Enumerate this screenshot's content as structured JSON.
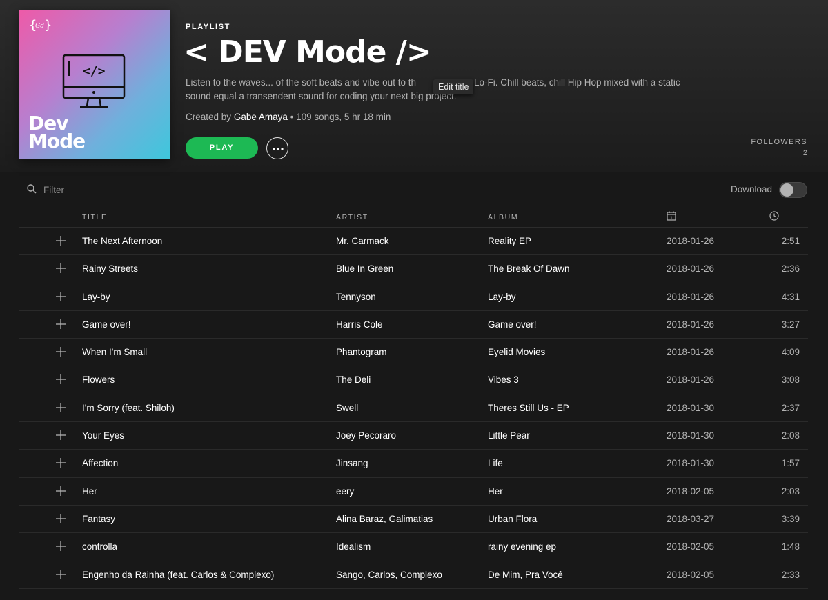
{
  "playlist": {
    "type_label": "PLAYLIST",
    "title": "< DEV Mode />",
    "description": "Listen to the waves... of the soft beats and vibe out to the Lo-Fi. Chill beats, chill Hip Hop mixed with a static sound equal a transendent sound for coding your next big project.",
    "description_line1": "Listen to the waves... of the soft beats and vibe out to th",
    "description_line1b": "Lo-Fi. Chill beats, chill Hip Hop mixed with a static",
    "description_line2": "sound equal a transendent sound for coding your next big project.",
    "created_by_prefix": "Created by",
    "owner": "Gabe Amaya",
    "stats": "• 109 songs, 5 hr 18 min",
    "tooltip": "Edit title",
    "cover": {
      "title_line1": "Dev",
      "title_line2": "Mode",
      "gradient": [
        "#ee5aa8",
        "#3ec7dc"
      ]
    }
  },
  "actions": {
    "play_label": "PLAY",
    "more_icon": "ellipsis-icon"
  },
  "followers": {
    "label": "FOLLOWERS",
    "count": "2"
  },
  "filter": {
    "placeholder": "Filter",
    "icon": "search-icon"
  },
  "download": {
    "label": "Download",
    "enabled": false
  },
  "columns": {
    "title": "TITLE",
    "artist": "ARTIST",
    "album": "ALBUM",
    "date_icon": "calendar-icon",
    "duration_icon": "clock-icon"
  },
  "tracks": [
    {
      "title": "The Next Afternoon",
      "artist": "Mr. Carmack",
      "album": "Reality EP",
      "added": "2018-01-26",
      "duration": "2:51"
    },
    {
      "title": "Rainy Streets",
      "artist": "Blue In Green",
      "album": "The Break Of Dawn",
      "added": "2018-01-26",
      "duration": "2:36"
    },
    {
      "title": "Lay-by",
      "artist": "Tennyson",
      "album": "Lay-by",
      "added": "2018-01-26",
      "duration": "4:31"
    },
    {
      "title": "Game over!",
      "artist": "Harris Cole",
      "album": "Game over!",
      "added": "2018-01-26",
      "duration": "3:27"
    },
    {
      "title": "When I'm Small",
      "artist": "Phantogram",
      "album": "Eyelid Movies",
      "added": "2018-01-26",
      "duration": "4:09"
    },
    {
      "title": "Flowers",
      "artist": "The Deli",
      "album": "Vibes 3",
      "added": "2018-01-26",
      "duration": "3:08"
    },
    {
      "title": "I'm Sorry (feat. Shiloh)",
      "artist": "Swell",
      "album": "Theres Still Us - EP",
      "added": "2018-01-30",
      "duration": "2:37"
    },
    {
      "title": "Your Eyes",
      "artist": "Joey Pecoraro",
      "album": "Little Pear",
      "added": "2018-01-30",
      "duration": "2:08"
    },
    {
      "title": "Affection",
      "artist": "Jinsang",
      "album": "Life",
      "added": "2018-01-30",
      "duration": "1:57"
    },
    {
      "title": "Her",
      "artist": "eery",
      "album": "Her",
      "added": "2018-02-05",
      "duration": "2:03"
    },
    {
      "title": "Fantasy",
      "artist": "Alina Baraz, Galimatias",
      "album": "Urban Flora",
      "added": "2018-03-27",
      "duration": "3:39"
    },
    {
      "title": "controlla",
      "artist": "Idealism",
      "album": "rainy evening ep",
      "added": "2018-02-05",
      "duration": "1:48"
    },
    {
      "title": "Engenho da Rainha (feat. Carlos & Complexo)",
      "artist": "Sango, Carlos, Complexo",
      "album": "De Mim, Pra Você",
      "added": "2018-02-05",
      "duration": "2:33"
    }
  ]
}
